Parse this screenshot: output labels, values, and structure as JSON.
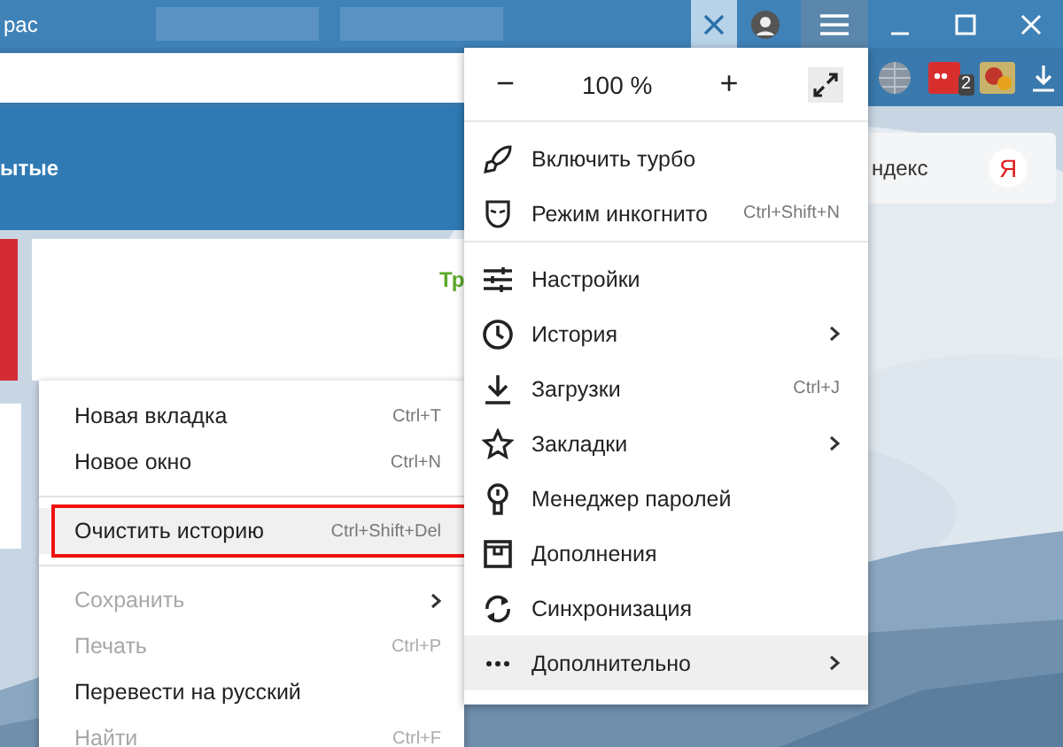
{
  "tab_strip": {
    "first_tab_title": "рас"
  },
  "toolbar": {
    "extension_badge": "2"
  },
  "page": {
    "section_heading": "ытые",
    "tile_text": "Тр",
    "yandex_card": {
      "text": "ндекс",
      "logo": "Я"
    }
  },
  "main_menu": {
    "zoom": {
      "minus": "−",
      "value": "100 %",
      "plus": "+"
    },
    "groups": [
      {
        "items": [
          {
            "label": "Включить турбо",
            "selected": false,
            "submenu": false
          },
          {
            "label": "Режим инкогнито",
            "shortcut": "Ctrl+Shift+N",
            "selected": false,
            "submenu": false
          }
        ]
      },
      {
        "items": [
          {
            "label": "Настройки",
            "selected": false,
            "submenu": false
          },
          {
            "label": "История",
            "selected": false,
            "submenu": true
          },
          {
            "label": "Загрузки",
            "shortcut": "Ctrl+J",
            "selected": false,
            "submenu": false
          },
          {
            "label": "Закладки",
            "selected": false,
            "submenu": true
          },
          {
            "label": "Менеджер паролей",
            "selected": false,
            "submenu": false
          },
          {
            "label": "Дополнения",
            "selected": false,
            "submenu": false
          },
          {
            "label": "Синхронизация",
            "selected": false,
            "submenu": false
          },
          {
            "label": "Дополнительно",
            "selected": true,
            "submenu": true
          }
        ]
      }
    ]
  },
  "context_menu": {
    "groups": [
      {
        "items": [
          {
            "label": "Новая вкладка",
            "shortcut": "Ctrl+T",
            "selected": false,
            "disabled": false,
            "submenu": false,
            "outlined": false
          },
          {
            "label": "Новое окно",
            "shortcut": "Ctrl+N",
            "selected": false,
            "disabled": false,
            "submenu": false,
            "outlined": false
          }
        ]
      },
      {
        "items": [
          {
            "label": "Очистить историю",
            "shortcut": "Ctrl+Shift+Del",
            "selected": true,
            "disabled": false,
            "submenu": false,
            "outlined": true
          }
        ]
      },
      {
        "items": [
          {
            "label": "Сохранить",
            "selected": false,
            "disabled": true,
            "submenu": true,
            "outlined": false
          },
          {
            "label": "Печать",
            "shortcut": "Ctrl+P",
            "selected": false,
            "disabled": true,
            "submenu": false,
            "outlined": false
          },
          {
            "label": "Перевести на русский",
            "selected": false,
            "disabled": false,
            "submenu": false,
            "outlined": false
          },
          {
            "label": "Найти",
            "shortcut": "Ctrl+F",
            "selected": false,
            "disabled": true,
            "submenu": false,
            "outlined": false
          }
        ]
      }
    ]
  }
}
